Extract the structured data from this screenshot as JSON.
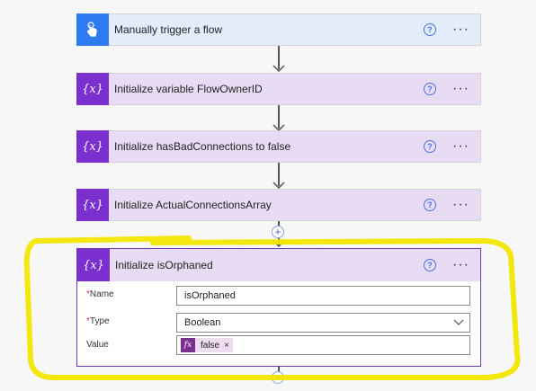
{
  "steps": [
    {
      "title": "Manually trigger a flow",
      "type": "trigger"
    },
    {
      "title": "Initialize variable FlowOwnerID",
      "type": "variable"
    },
    {
      "title": "Initialize hasBadConnections to false",
      "type": "variable"
    },
    {
      "title": "Initialize ActualConnectionsArray",
      "type": "variable"
    }
  ],
  "expanded_step": {
    "title": "Initialize isOrphaned",
    "fields": {
      "name": {
        "label": "Name",
        "required_mark": "*",
        "value": "isOrphaned"
      },
      "type": {
        "label": "Type",
        "required_mark": "*",
        "value": "Boolean"
      },
      "value": {
        "label": "Value",
        "token_label": "false",
        "token_icon": "fx",
        "token_remove": "×"
      }
    }
  },
  "ui": {
    "help_glyph": "?",
    "more_glyph": "···",
    "add_glyph": "+",
    "variable_icon_text": "{x}"
  },
  "colors": {
    "trigger_accent": "#2e7bf0",
    "variable_accent": "#7b2fce",
    "highlight": "#f2e600"
  }
}
